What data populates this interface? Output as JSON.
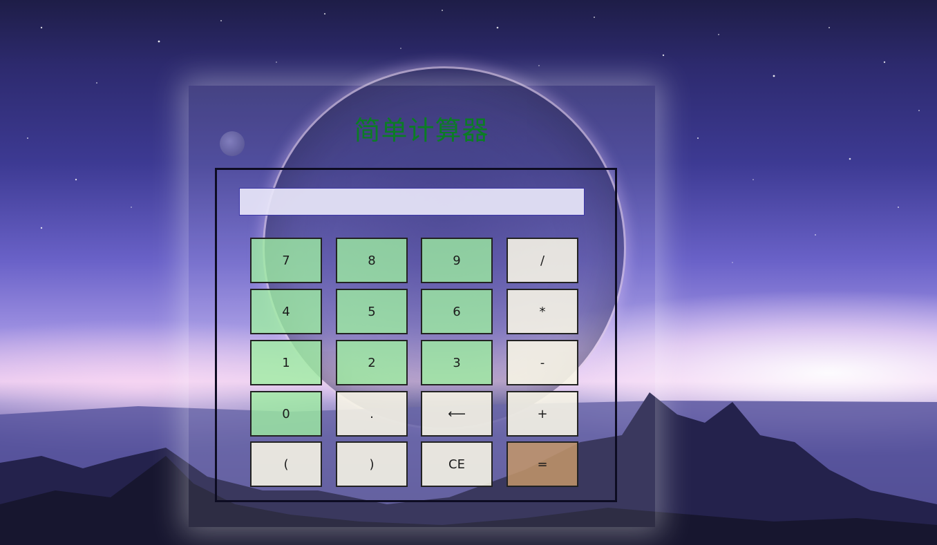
{
  "app": {
    "title": "简单计算器"
  },
  "display": {
    "value": "",
    "placeholder": ""
  },
  "keys": {
    "seven": "7",
    "eight": "8",
    "nine": "9",
    "divide": "/",
    "four": "4",
    "five": "5",
    "six": "6",
    "multiply": "*",
    "one": "1",
    "two": "2",
    "three": "3",
    "minus": "-",
    "zero": "0",
    "dot": ".",
    "backspace": "⟵",
    "plus": "+",
    "lparen": "(",
    "rparen": ")",
    "clear": "CE",
    "equals": "="
  },
  "colors": {
    "title": "#0b7d24",
    "digit_key": "#9ef0a0",
    "operator_key": "#f8f6e6",
    "equals_key": "#c49669",
    "display_border": "#3b35a8"
  }
}
